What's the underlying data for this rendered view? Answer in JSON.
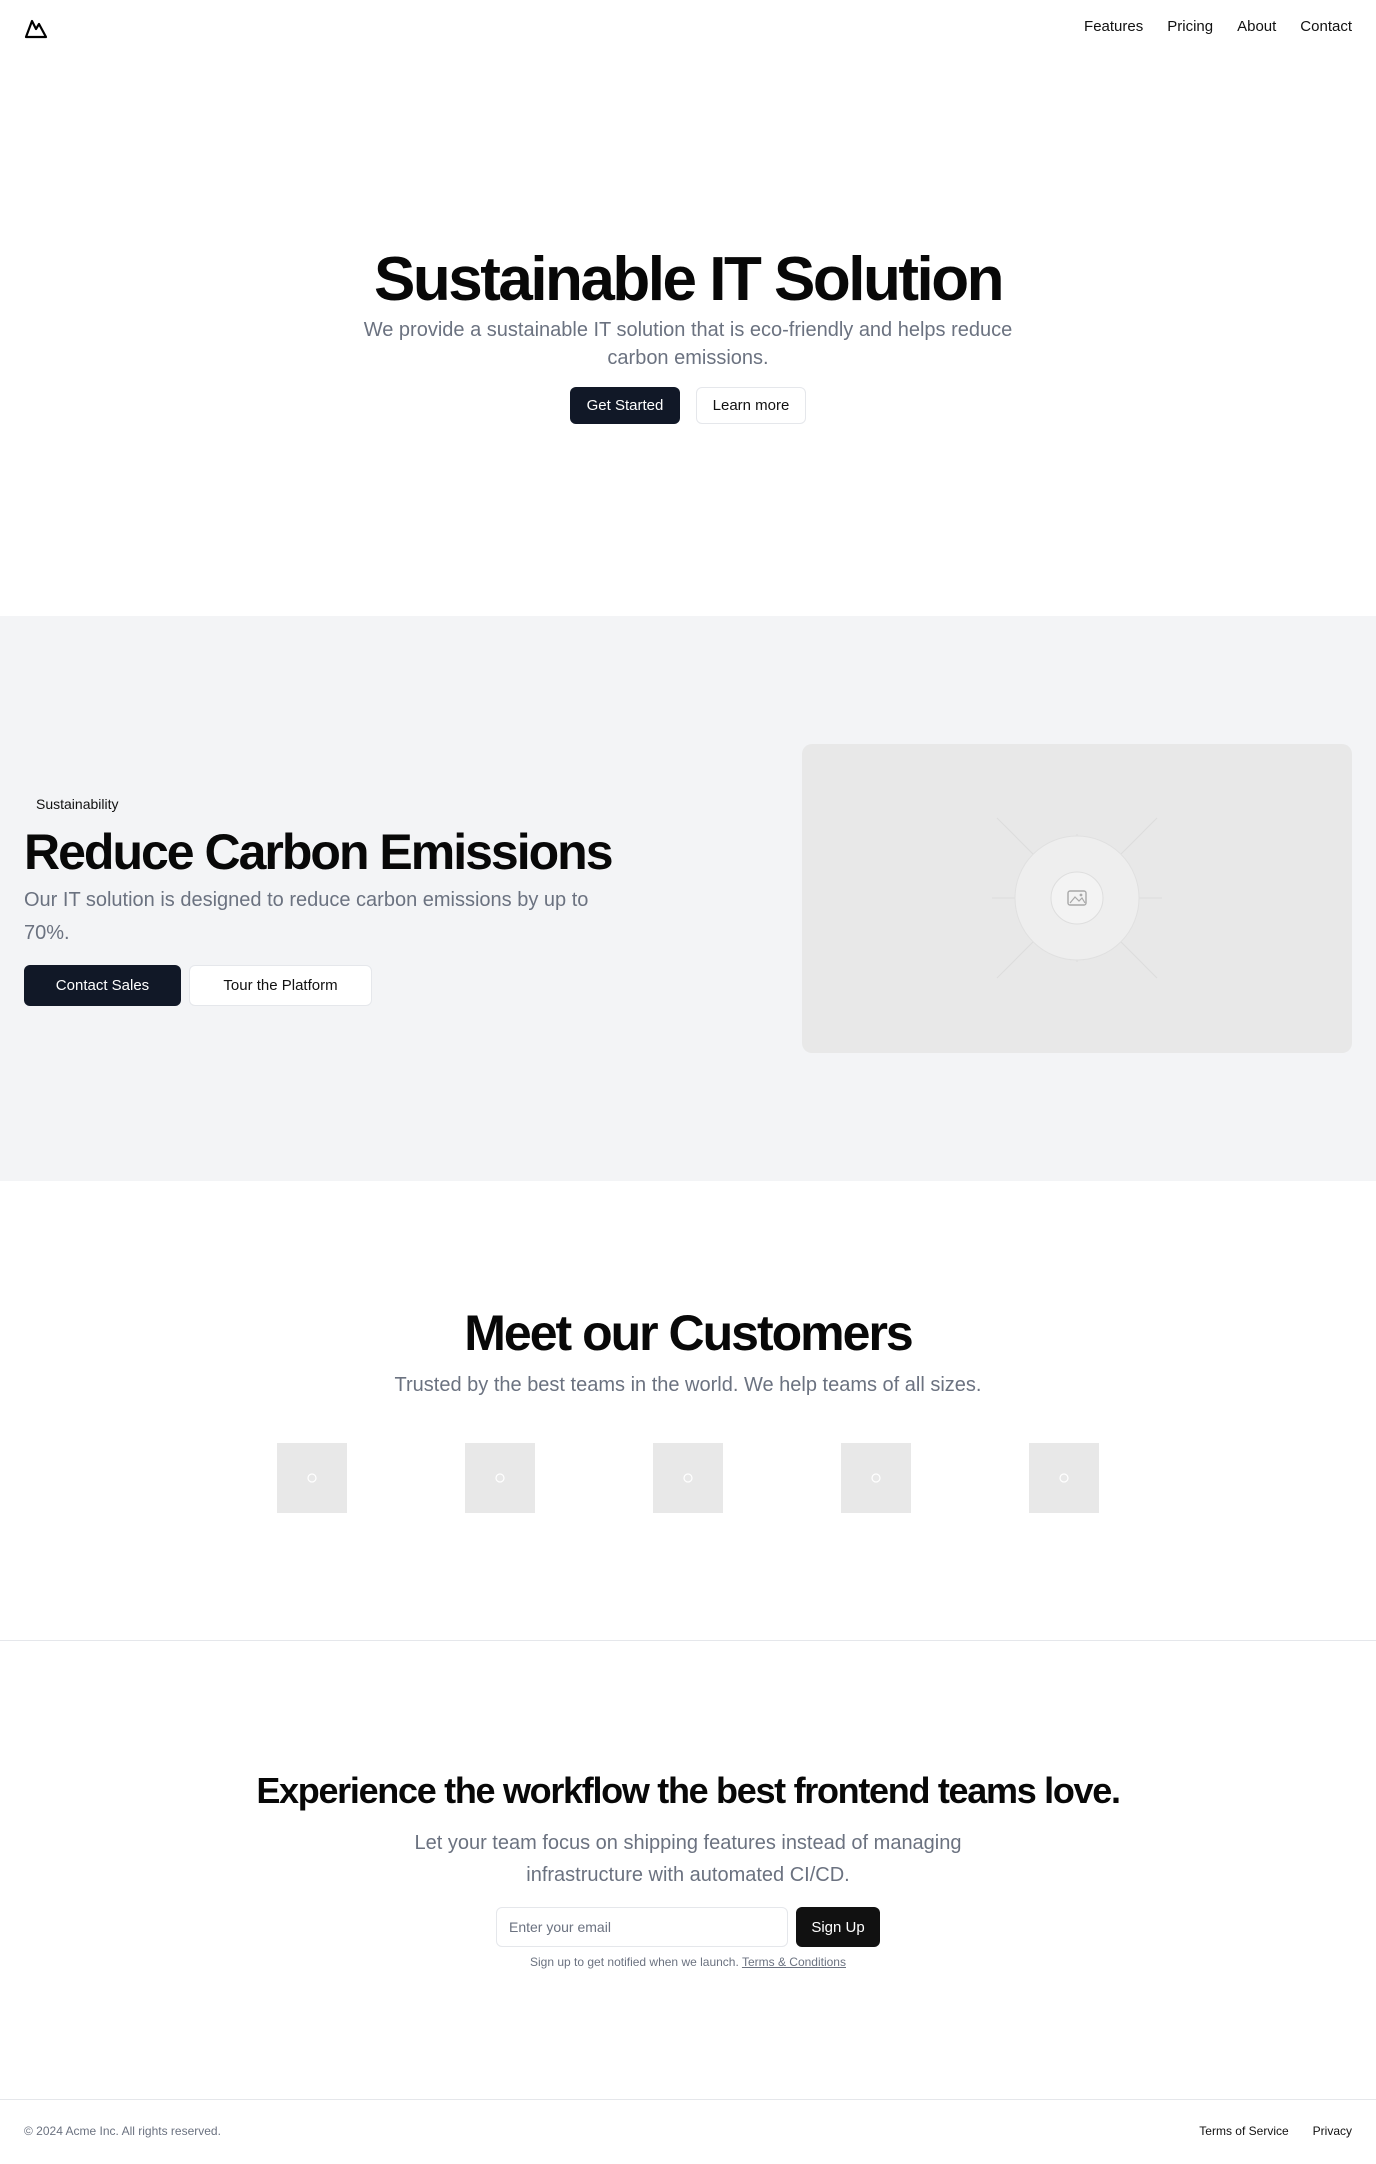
{
  "header": {
    "logo_icon": "mountain-icon",
    "nav": [
      {
        "label": "Features"
      },
      {
        "label": "Pricing"
      },
      {
        "label": "About"
      },
      {
        "label": "Contact"
      }
    ]
  },
  "hero": {
    "title": "Sustainable IT Solution",
    "subtitle": "We provide a sustainable IT solution that is eco-friendly and helps reduce carbon emissions.",
    "primary_button": "Get Started",
    "secondary_button": "Learn more"
  },
  "sustainability": {
    "badge": "Sustainability",
    "title": "Reduce Carbon Emissions",
    "text": "Our IT solution is designed to reduce carbon emissions by up to 70%.",
    "primary_button": "Contact Sales",
    "secondary_button": "Tour the Platform",
    "image_icon": "image-placeholder-icon"
  },
  "customers": {
    "title": "Meet our Customers",
    "subtitle": "Trusted by the best teams in the world. We help teams of all sizes.",
    "logo_count": 5
  },
  "cta": {
    "title": "Experience the workflow the best frontend teams love.",
    "text": "Let your team focus on shipping features instead of managing infrastructure with automated CI/CD.",
    "email_placeholder": "Enter your email",
    "signup_button": "Sign Up",
    "fine_print": "Sign up to get notified when we launch.",
    "terms_link": "Terms & Conditions"
  },
  "footer": {
    "copyright": "© 2024 Acme Inc. All rights reserved.",
    "links": [
      {
        "label": "Terms of Service"
      },
      {
        "label": "Privacy"
      }
    ]
  },
  "colors": {
    "primary_button": "#111827",
    "muted_text": "#6b7280",
    "section_bg": "#f3f4f6",
    "placeholder_bg": "#e8e8e8"
  }
}
